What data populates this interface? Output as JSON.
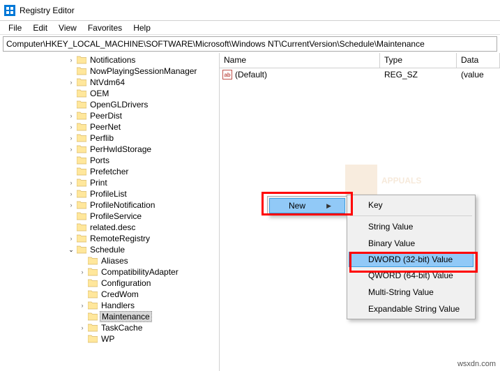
{
  "window": {
    "title": "Registry Editor"
  },
  "menubar": {
    "file": "File",
    "edit": "Edit",
    "view": "View",
    "favorites": "Favorites",
    "help": "Help"
  },
  "path": "Computer\\HKEY_LOCAL_MACHINE\\SOFTWARE\\Microsoft\\Windows NT\\CurrentVersion\\Schedule\\Maintenance",
  "tree": {
    "items": [
      {
        "label": "Notifications",
        "depth": 6,
        "expander": ">"
      },
      {
        "label": "NowPlayingSessionManager",
        "depth": 6,
        "expander": ""
      },
      {
        "label": "NtVdm64",
        "depth": 6,
        "expander": ">"
      },
      {
        "label": "OEM",
        "depth": 6,
        "expander": ""
      },
      {
        "label": "OpenGLDrivers",
        "depth": 6,
        "expander": ""
      },
      {
        "label": "PeerDist",
        "depth": 6,
        "expander": ">"
      },
      {
        "label": "PeerNet",
        "depth": 6,
        "expander": ">"
      },
      {
        "label": "Perflib",
        "depth": 6,
        "expander": ">"
      },
      {
        "label": "PerHwIdStorage",
        "depth": 6,
        "expander": ">"
      },
      {
        "label": "Ports",
        "depth": 6,
        "expander": ""
      },
      {
        "label": "Prefetcher",
        "depth": 6,
        "expander": ""
      },
      {
        "label": "Print",
        "depth": 6,
        "expander": ">"
      },
      {
        "label": "ProfileList",
        "depth": 6,
        "expander": ">"
      },
      {
        "label": "ProfileNotification",
        "depth": 6,
        "expander": ">"
      },
      {
        "label": "ProfileService",
        "depth": 6,
        "expander": ""
      },
      {
        "label": "related.desc",
        "depth": 6,
        "expander": ""
      },
      {
        "label": "RemoteRegistry",
        "depth": 6,
        "expander": ">"
      },
      {
        "label": "Schedule",
        "depth": 6,
        "expander": "v"
      },
      {
        "label": "Aliases",
        "depth": 7,
        "expander": ""
      },
      {
        "label": "CompatibilityAdapter",
        "depth": 7,
        "expander": ">"
      },
      {
        "label": "Configuration",
        "depth": 7,
        "expander": ""
      },
      {
        "label": "CredWom",
        "depth": 7,
        "expander": ""
      },
      {
        "label": "Handlers",
        "depth": 7,
        "expander": ">"
      },
      {
        "label": "Maintenance",
        "depth": 7,
        "expander": "",
        "selected": true
      },
      {
        "label": "TaskCache",
        "depth": 7,
        "expander": ">"
      },
      {
        "label": "WP",
        "depth": 7,
        "expander": ""
      }
    ]
  },
  "values": {
    "headers": {
      "name": "Name",
      "type": "Type",
      "data": "Data"
    },
    "rows": [
      {
        "name": "(Default)",
        "type": "REG_SZ",
        "data": "(value"
      }
    ]
  },
  "context_menu": {
    "new_label": "New",
    "submenu": {
      "key": "Key",
      "string": "String Value",
      "binary": "Binary Value",
      "dword": "DWORD (32-bit) Value",
      "qword": "QWORD (64-bit) Value",
      "multi": "Multi-String Value",
      "expand": "Expandable String Value"
    }
  },
  "watermark": {
    "text": "APPUALS"
  },
  "attribution": "wsxdn.com"
}
